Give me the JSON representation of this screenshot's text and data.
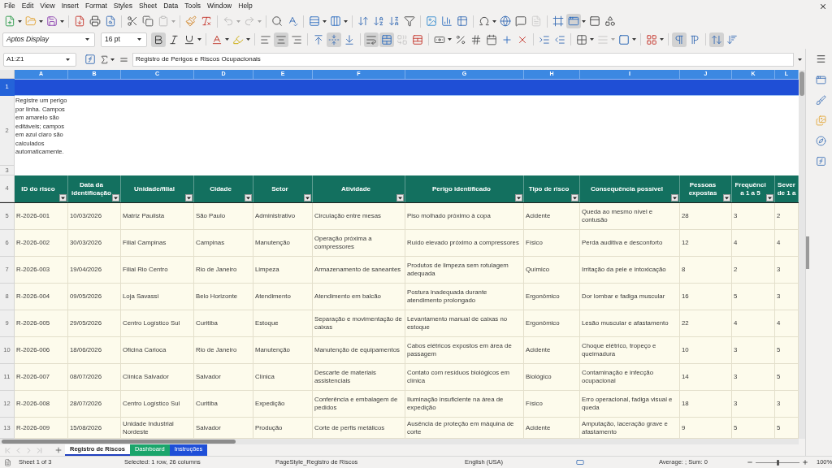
{
  "menu": [
    "File",
    "Edit",
    "View",
    "Insert",
    "Format",
    "Styles",
    "Sheet",
    "Data",
    "Tools",
    "Window",
    "Help"
  ],
  "standard_toolbar": {
    "disabled": {
      "paste": true,
      "undo": true,
      "redo": true,
      "headers_footers": true
    },
    "pressed": {
      "freeze": true
    }
  },
  "formatting_toolbar": {
    "font_name": "Aptos Display",
    "font_size": "16 pt",
    "pressed": {
      "bold": true,
      "italic": false,
      "underline": false,
      "align_left": false,
      "align_center": true,
      "align_right": false,
      "align_top": false,
      "align_middle": true,
      "align_bottom": false,
      "wrap_text": true,
      "merge_center": true,
      "left_to_right": true,
      "right_to_left": false,
      "stacked": true
    },
    "disabled": {
      "merge_cells": true,
      "border_style": true
    }
  },
  "formula_bar": {
    "name_box": "A1:Z1",
    "content": "Registro de Perigos e Riscos Ocupacionais"
  },
  "sheet": {
    "column_headers": [
      {
        "label": "A",
        "selected": true
      },
      {
        "label": "B",
        "selected": true
      },
      {
        "label": "C",
        "selected": true
      },
      {
        "label": "D",
        "selected": true
      },
      {
        "label": "E",
        "selected": true
      },
      {
        "label": "F",
        "selected": true
      },
      {
        "label": "G",
        "selected": true
      },
      {
        "label": "H",
        "selected": true
      },
      {
        "label": "I",
        "selected": true
      },
      {
        "label": "J",
        "selected": true
      },
      {
        "label": "K",
        "selected": true
      },
      {
        "label": "L",
        "selected": true
      }
    ],
    "row_headers": [
      {
        "label": "1",
        "selected": true
      },
      {
        "label": "2",
        "selected": false
      },
      {
        "label": "3",
        "selected": false
      },
      {
        "label": "4",
        "selected": false
      },
      {
        "label": "5",
        "selected": false
      },
      {
        "label": "6",
        "selected": false
      },
      {
        "label": "7",
        "selected": false
      },
      {
        "label": "8",
        "selected": false
      },
      {
        "label": "9",
        "selected": false
      },
      {
        "label": "10",
        "selected": false
      },
      {
        "label": "11",
        "selected": false
      },
      {
        "label": "12",
        "selected": false
      },
      {
        "label": "13",
        "selected": false
      }
    ],
    "note": "Registre um perigo por linha. Campos em amarelo são editáveis; campos em azul claro são calculados automaticamente.",
    "columns": [
      {
        "label": "ID do risco",
        "filter": true
      },
      {
        "label": "Data da identificação",
        "filter": true
      },
      {
        "label": "Unidade/filial",
        "filter": true
      },
      {
        "label": "Cidade",
        "filter": true
      },
      {
        "label": "Setor",
        "filter": true
      },
      {
        "label": "Atividade",
        "filter": true
      },
      {
        "label": "Perigo identificado",
        "filter": true
      },
      {
        "label": "Tipo de risco",
        "filter": true
      },
      {
        "label": "Consequência possível",
        "filter": true
      },
      {
        "label": "Pessoas expostas",
        "filter": true
      },
      {
        "label": "Frequência 1 a 5",
        "filter": true
      },
      {
        "label": "Sever de 1 a",
        "filter": false
      }
    ],
    "rows": [
      [
        "R-2026-001",
        "10/03/2026",
        "Matriz Paulista",
        "São Paulo",
        "Administrativo",
        "Circulação entre mesas",
        "Piso molhado próximo à copa",
        "Acidente",
        "Queda ao mesmo nível e contusão",
        "28",
        "3",
        "2"
      ],
      [
        "R-2026-002",
        "30/03/2026",
        "Filial Campinas",
        "Campinas",
        "Manutenção",
        "Operação próxima a compressores",
        "Ruído elevado próximo a compressores",
        "Físico",
        "Perda auditiva e desconforto",
        "12",
        "4",
        "4"
      ],
      [
        "R-2026-003",
        "19/04/2026",
        "Filial Rio Centro",
        "Rio de Janeiro",
        "Limpeza",
        "Armazenamento de saneantes",
        "Produtos de limpeza sem rotulagem adequada",
        "Químico",
        "Irritação da pele e intoxicação",
        "8",
        "2",
        "3"
      ],
      [
        "R-2026-004",
        "09/05/2026",
        "Loja Savassi",
        "Belo Horizonte",
        "Atendimento",
        "Atendimento em balcão",
        "Postura inadequada durante atendimento prolongado",
        "Ergonômico",
        "Dor lombar e fadiga muscular",
        "16",
        "5",
        "3"
      ],
      [
        "R-2026-005",
        "29/05/2026",
        "Centro Logístico Sul",
        "Curitiba",
        "Estoque",
        "Separação e movimentação de caixas",
        "Levantamento manual de caixas no estoque",
        "Ergonômico",
        "Lesão muscular e afastamento",
        "22",
        "4",
        "4"
      ],
      [
        "R-2026-006",
        "18/06/2026",
        "Oficina Carioca",
        "Rio de Janeiro",
        "Manutenção",
        "Manutenção de equipamentos",
        "Cabos elétricos expostos em área de passagem",
        "Acidente",
        "Choque elétrico, tropeço e queimadura",
        "10",
        "3",
        "5"
      ],
      [
        "R-2026-007",
        "08/07/2026",
        "Clínica Salvador",
        "Salvador",
        "Clínica",
        "Descarte de materiais assistenciais",
        "Contato com resíduos biológicos em clínica",
        "Biológico",
        "Contaminação e infecção ocupacional",
        "14",
        "3",
        "5"
      ],
      [
        "R-2026-008",
        "28/07/2026",
        "Centro Logístico Sul",
        "Curitiba",
        "Expedição",
        "Conferência e embalagem de pedidos",
        "Iluminação insuficiente na área de expedição",
        "Físico",
        "Erro operacional, fadiga visual e queda",
        "18",
        "3",
        "3"
      ],
      [
        "R-2026-009",
        "15/08/2026",
        "Unidade Industrial Nordeste",
        "Salvador",
        "Produção",
        "Corte de perfis metálicos",
        "Ausência de proteção em máquina de corte",
        "Acidente",
        "Amputação, laceração grave e afastamento",
        "9",
        "5",
        "5"
      ]
    ]
  },
  "sheet_tabs": [
    {
      "label": "Registro de Riscos",
      "selected": true,
      "color": "#1f3fbf"
    },
    {
      "label": "Dashboard",
      "selected": false,
      "color": "#1aa56b"
    },
    {
      "label": "Instruções",
      "selected": false,
      "color": "#1f4fd8"
    }
  ],
  "status_bar": {
    "sheet": "Sheet 1 of 3",
    "selection": "Selected: 1 row, 26 columns",
    "page_style": "PageStyle_Registro de Riscos",
    "language": "English (USA)",
    "summary": "Average: ; Sum: 0",
    "zoom": {
      "level": 0.5,
      "reading": "100%"
    }
  }
}
